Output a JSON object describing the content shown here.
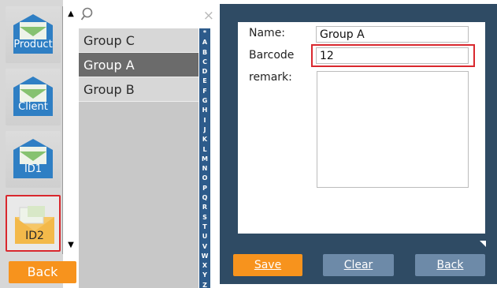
{
  "sidebar": {
    "items": [
      {
        "label": "Product",
        "icon": "envelope-icon"
      },
      {
        "label": "Client",
        "icon": "envelope-icon"
      },
      {
        "label": "ID1",
        "icon": "envelope-icon"
      },
      {
        "label": "ID2",
        "icon": "open-envelope-icon",
        "selected": true
      }
    ],
    "back_label": "Back"
  },
  "search": {
    "value": "",
    "placeholder": ""
  },
  "groups": [
    {
      "label": "Group C"
    },
    {
      "label": "Group A",
      "selected": true
    },
    {
      "label": "Group B"
    }
  ],
  "alphabet": [
    "*",
    "A",
    "B",
    "C",
    "D",
    "E",
    "F",
    "G",
    "H",
    "I",
    "J",
    "K",
    "L",
    "M",
    "N",
    "O",
    "P",
    "Q",
    "R",
    "S",
    "T",
    "U",
    "V",
    "W",
    "X",
    "Y",
    "Z"
  ],
  "form": {
    "name_label": "Name:",
    "name_value": "Group A",
    "barcode_label": "Barcode",
    "barcode_value": "12",
    "remark_label": "remark:",
    "remark_value": ""
  },
  "buttons": {
    "save": "Save",
    "clear": "Clear",
    "back": "Back"
  },
  "colors": {
    "accent": "#f7931d",
    "panel": "#2f4b64",
    "highlight": "#d9282e",
    "index_bar": "#2d5b8b"
  }
}
